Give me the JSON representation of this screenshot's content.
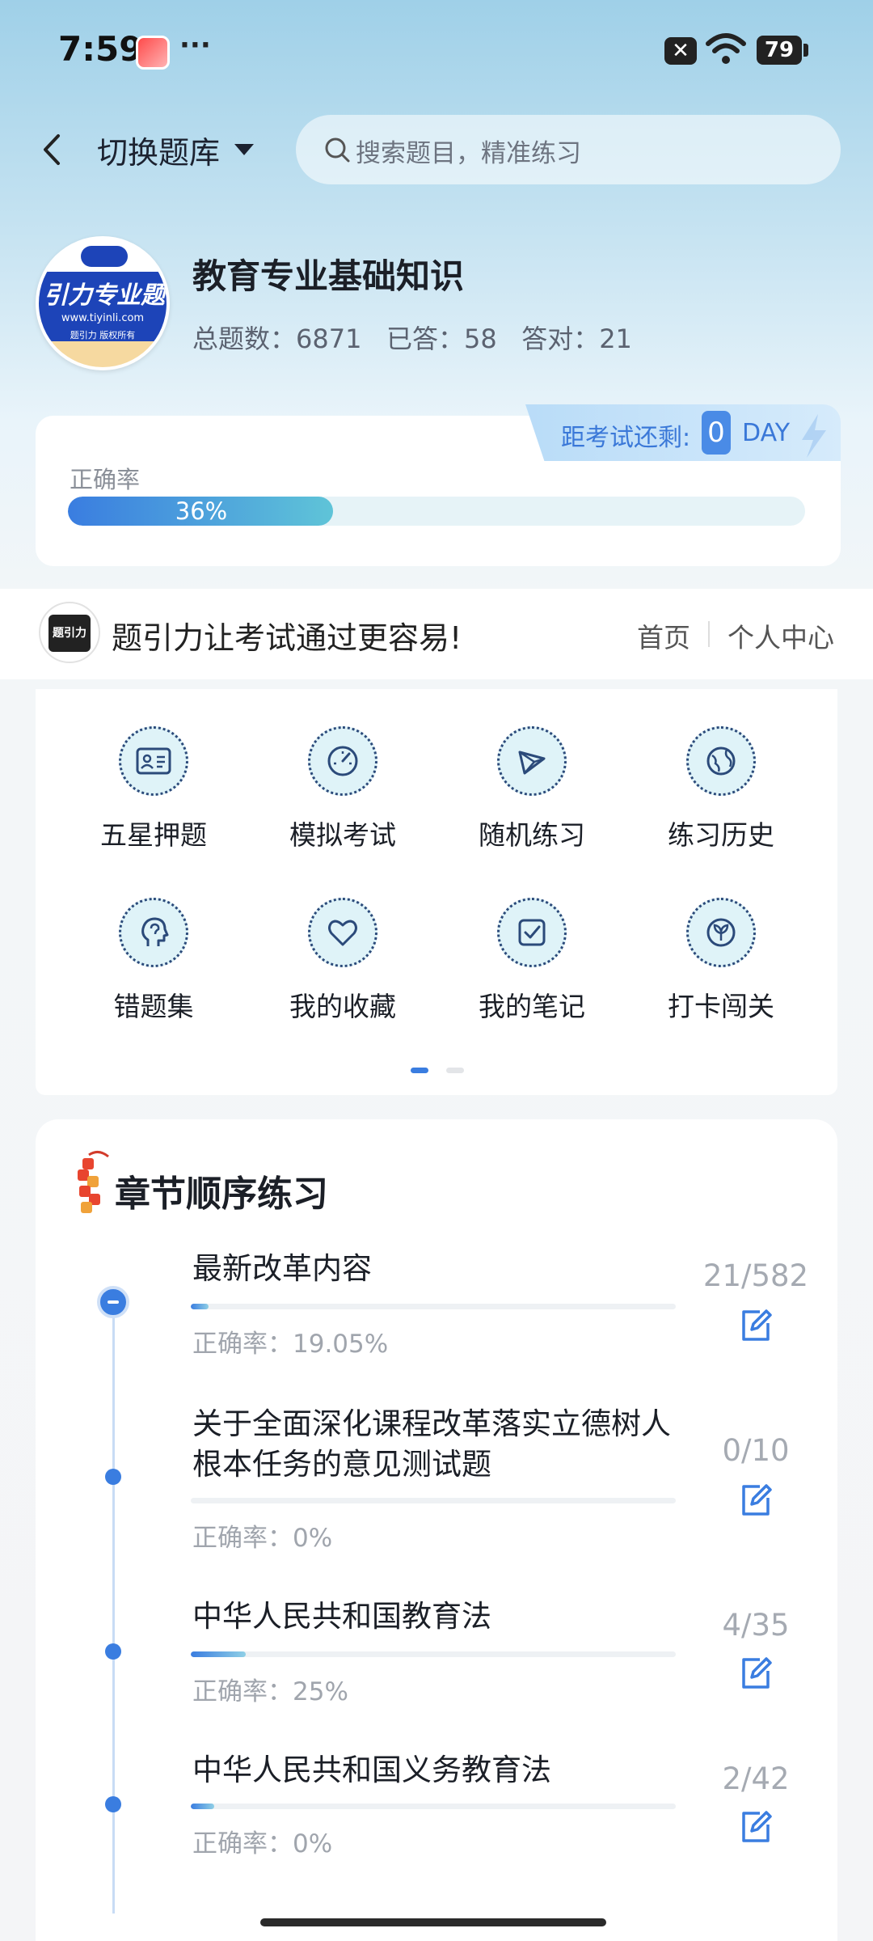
{
  "status_bar": {
    "time": "7:59",
    "dots": "···",
    "battery": "79",
    "x_label": "✕"
  },
  "top_bar": {
    "switch_label": "切换题库",
    "search_placeholder": "搜索题目，精准练习"
  },
  "subject": {
    "logo_text": "引力专业题",
    "logo_url": "www.tiyinli.com",
    "logo_sub": "题引力 版权所有",
    "title": "教育专业基础知识",
    "stats_text": "总题数：6871   已答：58   答对：21"
  },
  "exam_countdown": {
    "label": "距考试还剩:",
    "days": "0",
    "unit": "DAY"
  },
  "accuracy": {
    "label": "正确率",
    "percent_text": "36%",
    "percent": 36
  },
  "slogan_bar": {
    "logo_text": "题引力",
    "slogan": "题引力让考试通过更容易!",
    "nav_home": "首页",
    "nav_personal": "个人中心"
  },
  "features": [
    {
      "label": "五星押题",
      "icon": "id-card-icon"
    },
    {
      "label": "模拟考试",
      "icon": "gauge-icon"
    },
    {
      "label": "随机练习",
      "icon": "shuffle-icon"
    },
    {
      "label": "练习历史",
      "icon": "globe-icon"
    },
    {
      "label": "错题集",
      "icon": "head-icon"
    },
    {
      "label": "我的收藏",
      "icon": "heart-icon"
    },
    {
      "label": "我的笔记",
      "icon": "note-check-icon"
    },
    {
      "label": "打卡闯关",
      "icon": "badge-icon"
    }
  ],
  "chapters": {
    "title": "章节顺序练习",
    "items": [
      {
        "title": "最新改革内容",
        "accuracy": "正确率：19.05%",
        "count": "21/582",
        "progress": 0.036
      },
      {
        "title": "关于全面深化课程改革落实立德树人根本任务的意见测试题",
        "accuracy": "正确率：0%",
        "count": "0/10",
        "progress": 0
      },
      {
        "title": "中华人民共和国教育法",
        "accuracy": "正确率：25%",
        "count": "4/35",
        "progress": 0.114
      },
      {
        "title": "中华人民共和国义务教育法",
        "accuracy": "正确率：0%",
        "count": "2/42",
        "progress": 0.048
      }
    ]
  }
}
